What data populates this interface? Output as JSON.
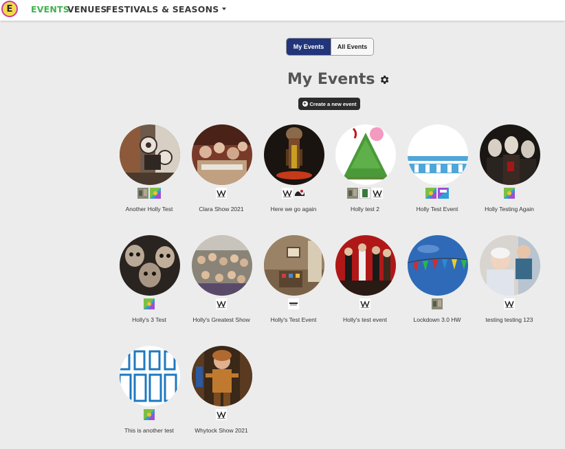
{
  "nav": {
    "logo_letter": "E",
    "links": [
      "EVENTS",
      "VENUES",
      "FESTIVALS & SEASONS"
    ]
  },
  "toggle": {
    "my_events": "My Events",
    "all_events": "All Events"
  },
  "page_title": "My Events",
  "create_button": "Create a new event",
  "events": [
    {
      "title": "Another Holly Test",
      "venues": [
        "photo-thumb",
        "colorful-thumb"
      ]
    },
    {
      "title": "Clara Show 2021",
      "venues": [
        "hw-logo"
      ]
    },
    {
      "title": "Here we go again",
      "venues": [
        "hw-logo",
        "dark-thumb"
      ]
    },
    {
      "title": "Holly test 2",
      "venues": [
        "photo-thumb",
        "green-thumb",
        "hw-logo"
      ]
    },
    {
      "title": "Holly Test Event",
      "venues": [
        "colorful-thumb",
        "colorful-thumb"
      ]
    },
    {
      "title": "Holly Testing Again",
      "venues": [
        "colorful-thumb"
      ]
    },
    {
      "title": "Holly's 3 Test",
      "venues": [
        "colorful-thumb"
      ]
    },
    {
      "title": "Holly's Greatest Show",
      "venues": [
        "hw-logo"
      ]
    },
    {
      "title": "Holly's Test Event",
      "venues": [
        "text-logo"
      ]
    },
    {
      "title": "Holly's test event",
      "venues": [
        "hw-logo"
      ]
    },
    {
      "title": "Lockdown 3.0 HW",
      "venues": [
        "photo-thumb"
      ]
    },
    {
      "title": "testing testing 123",
      "venues": [
        "hw-logo"
      ]
    },
    {
      "title": "This is another test",
      "venues": [
        "colorful-thumb"
      ]
    },
    {
      "title": "Whytock Show 2021",
      "venues": [
        "hw-logo"
      ]
    }
  ],
  "colors": {
    "accent_green": "#3fb24f",
    "toggle_active": "#22357a",
    "logo_border": "#c53da2",
    "logo_fill": "#f3d94a"
  }
}
